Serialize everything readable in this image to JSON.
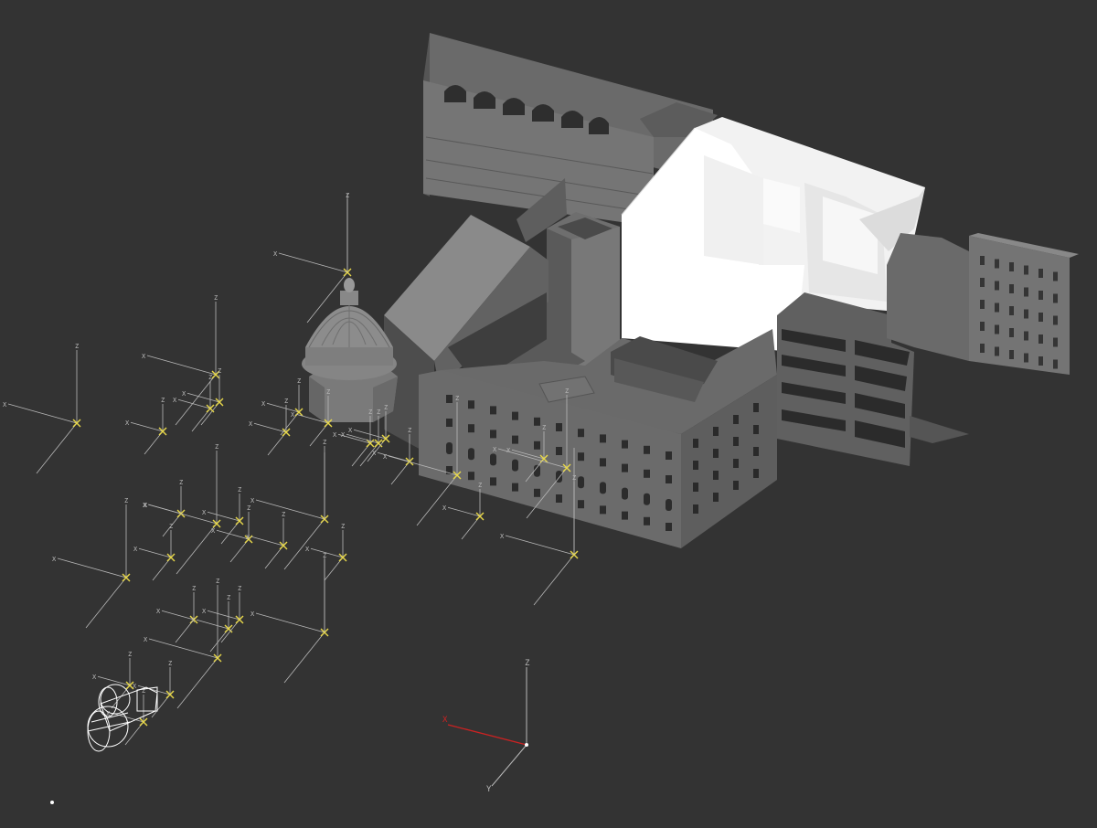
{
  "viewport": {
    "background": "#333333",
    "gizmo_stroke": "#b8b8b8",
    "helper_color": "#e8d84a",
    "world_x_axis_color": "#cc2222"
  },
  "axis_letters": {
    "x": "X",
    "y": "Y",
    "z": "Z"
  },
  "scene": {
    "main_building": "stone-office-building-model",
    "dome": "dome-model",
    "white_block": "white-massing-block",
    "side_buildings": [
      "right-facade-building",
      "section-cut-building"
    ],
    "camera": "camera-wireframe"
  }
}
